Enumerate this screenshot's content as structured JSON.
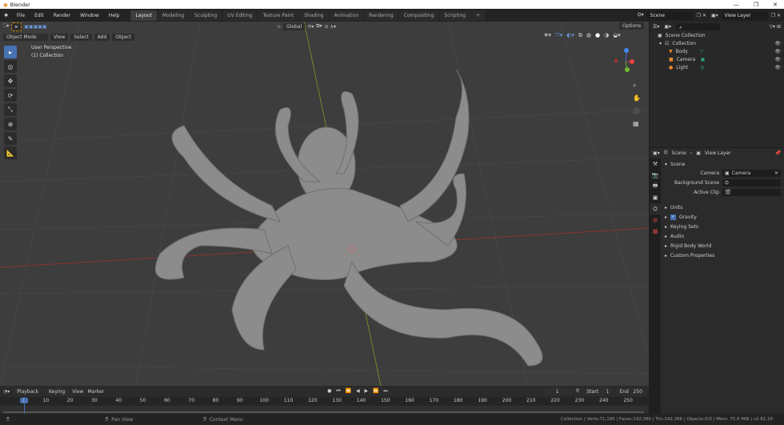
{
  "window": {
    "title": "Blender",
    "controls": [
      "—",
      "❐",
      "✕"
    ]
  },
  "menu": [
    "File",
    "Edit",
    "Render",
    "Window",
    "Help"
  ],
  "workspaces": [
    "Layout",
    "Modeling",
    "Sculpting",
    "UV Editing",
    "Texture Paint",
    "Shading",
    "Animation",
    "Rendering",
    "Compositing",
    "Scripting",
    "+"
  ],
  "active_workspace": "Layout",
  "scene": {
    "name": "Scene",
    "view_layer": "View Layer"
  },
  "viewport": {
    "mode": "Object Mode",
    "menus": [
      "View",
      "Select",
      "Add",
      "Object"
    ],
    "transform_orientation": "Global",
    "options": "Options",
    "overlay_text_1": "User Perspective",
    "overlay_text_2": "(1) Collection"
  },
  "outliner": {
    "search_placeholder": "",
    "root": "Scene Collection",
    "collection": "Collection",
    "objects": [
      {
        "name": "Body"
      },
      {
        "name": "Camera"
      },
      {
        "name": "Light"
      }
    ]
  },
  "properties": {
    "breadcrumb_scene": "Scene",
    "breadcrumb_layer": "View Layer",
    "section": "Scene",
    "fields": [
      {
        "label": "Camera",
        "value": "Camera"
      },
      {
        "label": "Background Scene",
        "value": ""
      },
      {
        "label": "Active Clip",
        "value": ""
      }
    ],
    "panels": [
      "Units",
      "Gravity",
      "Keying Sets",
      "Audio",
      "Rigid Body World",
      "Custom Properties"
    ],
    "gravity_checked": true
  },
  "timeline": {
    "menus": [
      "Playback",
      "Keying",
      "View",
      "Marker"
    ],
    "current_frame": "1",
    "start_label": "Start",
    "start": "1",
    "end_label": "End",
    "end": "250",
    "ticks": [
      "1",
      "10",
      "20",
      "30",
      "40",
      "50",
      "60",
      "70",
      "80",
      "90",
      "100",
      "110",
      "120",
      "130",
      "140",
      "150",
      "160",
      "170",
      "180",
      "190",
      "200",
      "210",
      "220",
      "230",
      "240",
      "250"
    ]
  },
  "statusbar": {
    "pan": "Pan View",
    "context": "Context Menu",
    "stats": "Collection | Verts:71,195 | Faces:142,386 | Tris:142,386 | Objects:0/3 | Mem: 75.6 MiB | v2.81.16"
  },
  "colors": {
    "accent": "#4772b3",
    "x_axis": "#b03a3a",
    "y_axis": "#7a9a2a"
  }
}
